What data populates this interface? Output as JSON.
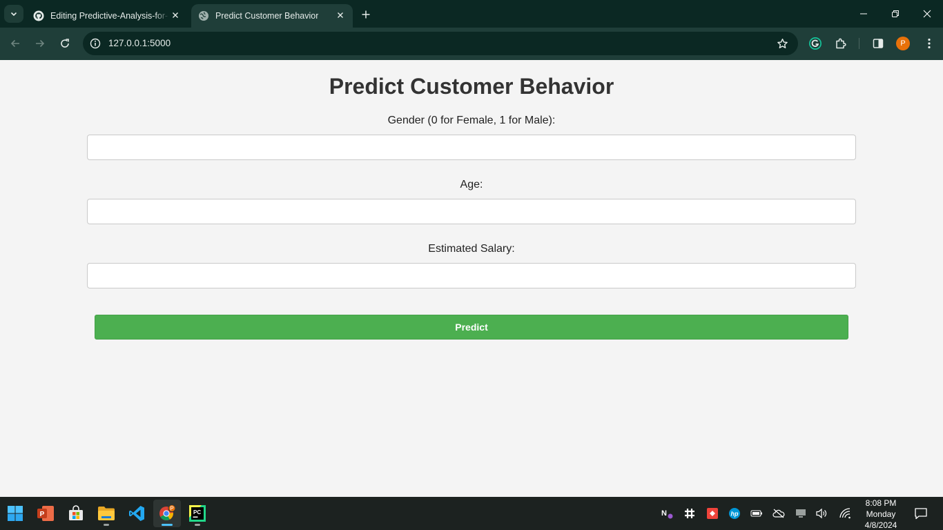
{
  "browser": {
    "tabs": [
      {
        "title": "Editing Predictive-Analysis-for-",
        "icon": "github-icon",
        "active": false
      },
      {
        "title": "Predict Customer Behavior",
        "icon": "globe-icon",
        "active": true
      }
    ],
    "url": "127.0.0.1:5000",
    "profile_initial": "P",
    "colors": {
      "frame": "#0b2823",
      "toolbar": "#1f3e39",
      "profile": "#e8710a"
    }
  },
  "page": {
    "title": "Predict Customer Behavior",
    "fields": [
      {
        "label": "Gender (0 for Female, 1 for Male):",
        "value": "",
        "placeholder": ""
      },
      {
        "label": "Age:",
        "value": "",
        "placeholder": ""
      },
      {
        "label": "Estimated Salary:",
        "value": "",
        "placeholder": ""
      }
    ],
    "submit_label": "Predict",
    "colors": {
      "background": "#f4f4f4",
      "button": "#4caf50"
    }
  },
  "taskbar": {
    "apps": [
      "start-icon",
      "powerpoint-icon",
      "microsoft-store-icon",
      "file-explorer-icon",
      "vscode-icon",
      "chrome-icon",
      "pycharm-icon"
    ],
    "clock": {
      "time": "8:08 PM",
      "day": "Monday",
      "date": "4/8/2024"
    }
  }
}
